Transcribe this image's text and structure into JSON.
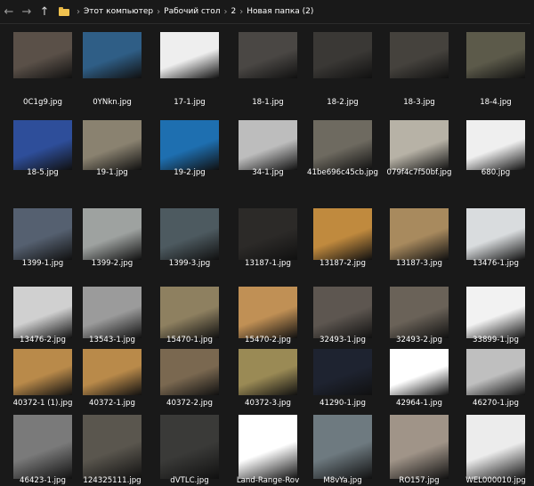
{
  "window": {
    "breadcrumbs": [
      "Этот компьютер",
      "Рабочий стол",
      "2",
      "Новая папка (2)"
    ],
    "nav": {
      "back": "←",
      "forward": "→",
      "up": "↑"
    }
  },
  "files": [
    {
      "name": "0C1g9.jpg",
      "bg": "#5a5048"
    },
    {
      "name": "0YNkn.jpg",
      "bg": "#2f5e86"
    },
    {
      "name": "17-1.jpg",
      "bg": "#eeeeee"
    },
    {
      "name": "18-1.jpg",
      "bg": "#4a4744"
    },
    {
      "name": "18-2.jpg",
      "bg": "#3a3835"
    },
    {
      "name": "18-3.jpg",
      "bg": "#45423d"
    },
    {
      "name": "18-4.jpg",
      "bg": "#5c5a4a"
    },
    {
      "name": "18-5.jpg",
      "bg": "#2e4e9a"
    },
    {
      "name": "19-1.jpg",
      "bg": "#8a8270"
    },
    {
      "name": "19-2.jpg",
      "bg": "#1e6fb0"
    },
    {
      "name": "34-1.jpg",
      "bg": "#bdbdbd"
    },
    {
      "name": "41be696c45cb.jpg",
      "bg": "#6e6a60"
    },
    {
      "name": "079f4c7f50bf.jpg",
      "bg": "#b7b2a6"
    },
    {
      "name": "680.jpg",
      "bg": "#efefef"
    },
    {
      "name": "1399-1.jpg",
      "bg": "#556070"
    },
    {
      "name": "1399-2.jpg",
      "bg": "#9ea2a0"
    },
    {
      "name": "1399-3.jpg",
      "bg": "#4d5a60"
    },
    {
      "name": "13187-1.jpg",
      "bg": "#2c2a28"
    },
    {
      "name": "13187-2.jpg",
      "bg": "#c08a3e"
    },
    {
      "name": "13187-3.jpg",
      "bg": "#a88a5e"
    },
    {
      "name": "13476-1.jpg",
      "bg": "#d9dcde"
    },
    {
      "name": "13476-2.jpg",
      "bg": "#d0d0d0"
    },
    {
      "name": "13543-1.jpg",
      "bg": "#9b9b9b"
    },
    {
      "name": "15470-1.jpg",
      "bg": "#8e8060"
    },
    {
      "name": "15470-2.jpg",
      "bg": "#c09055"
    },
    {
      "name": "32493-1.jpg",
      "bg": "#5d5650"
    },
    {
      "name": "32493-2.jpg",
      "bg": "#6a6258"
    },
    {
      "name": "33899-1.jpg",
      "bg": "#f2f2f2"
    },
    {
      "name": "40372-1 (1).jpg",
      "bg": "#b98a4a"
    },
    {
      "name": "40372-1.jpg",
      "bg": "#b98a4a"
    },
    {
      "name": "40372-2.jpg",
      "bg": "#7a6850"
    },
    {
      "name": "40372-3.jpg",
      "bg": "#9a8a55"
    },
    {
      "name": "41290-1.jpg",
      "bg": "#1e2330"
    },
    {
      "name": "42964-1.jpg",
      "bg": "#ffffff"
    },
    {
      "name": "46270-1.jpg",
      "bg": "#bfbfbf"
    },
    {
      "name": "46423-1.jpg",
      "bg": "#7a7a7a"
    },
    {
      "name": "124325111.jpg",
      "bg": "#5a564e"
    },
    {
      "name": "dVTLC.jpg",
      "bg": "#3a3a38"
    },
    {
      "name": "Land-Range-Rov",
      "bg": "#ffffff"
    },
    {
      "name": "M8vYa.jpg",
      "bg": "#6e7a80"
    },
    {
      "name": "RO157.jpg",
      "bg": "#a09488"
    },
    {
      "name": "WEL000010.jpg",
      "bg": "#ececec"
    }
  ]
}
